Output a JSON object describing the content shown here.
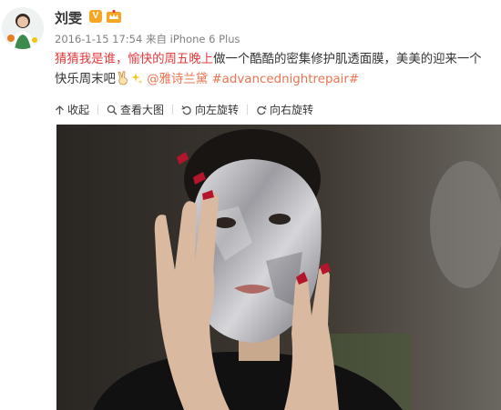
{
  "post": {
    "username": "刘雯",
    "verified_badge": "V",
    "timestamp": "2016-1-15 17:54",
    "source_prefix": "来自",
    "device": "iPhone 6 Plus",
    "text": {
      "red_part1": "猜猜我是谁，",
      "red_part2": "愉快的周五晚上",
      "line1_rest": "做一个酷酷的密集修护肌透面膜，美美的迎来一个",
      "line2_start": "快乐周末吧",
      "mention": "@雅诗兰黛",
      "hashtag": "#advancednightrepair#"
    }
  },
  "toolbar": {
    "collapse_label": "收起",
    "view_large_label": "查看大图",
    "rotate_left_label": "向左旋转",
    "rotate_right_label": "向右旋转"
  },
  "icons": {
    "avatar": "avatar-icon",
    "member": "member-crown-icon",
    "emoji_victory": "victory-hand-emoji",
    "emoji_sparkles": "sparkles-emoji",
    "collapse": "arrow-up-icon",
    "view_large": "magnifier-icon",
    "rotate_left": "rotate-left-icon",
    "rotate_right": "rotate-right-icon"
  },
  "colors": {
    "verified": "#f6a623",
    "highlight": "#e4393c",
    "link": "#eb7350"
  }
}
